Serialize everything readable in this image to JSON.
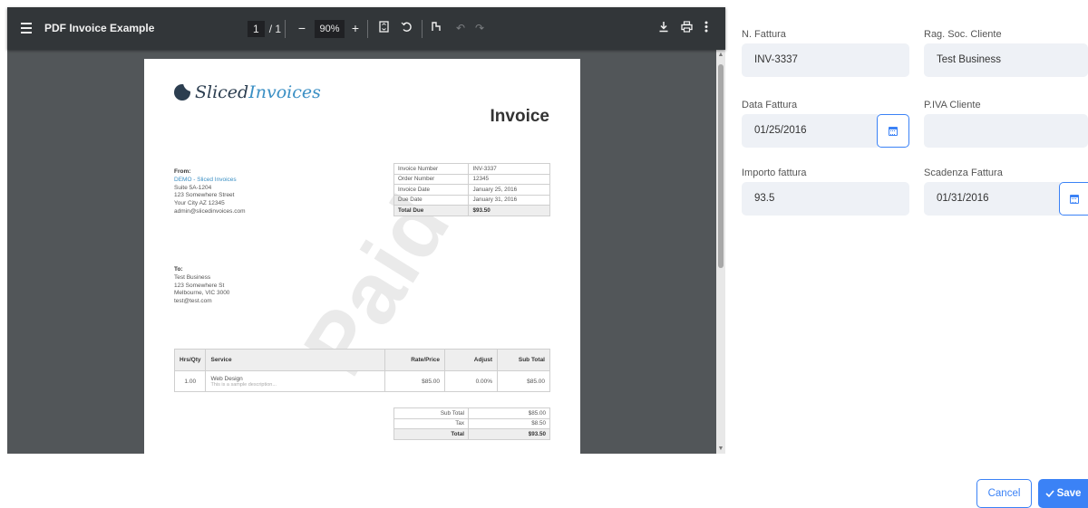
{
  "viewer": {
    "title": "PDF Invoice Example",
    "page_current": "1",
    "page_total": "/ 1",
    "zoom": "90%"
  },
  "pdf": {
    "logo_main": "Sliced",
    "logo_accent": "Invoices",
    "heading": "Invoice",
    "from": {
      "label": "From:",
      "name": "DEMO - Sliced Invoices",
      "line1": "Suite 5A-1204",
      "line2": "123 Somewhere Street",
      "line3": "Your City AZ 12345",
      "email": "admin@slicedinvoices.com"
    },
    "to": {
      "label": "To:",
      "name": "Test Business",
      "line1": "123 Somewhere St",
      "line2": "Melbourne, VIC 3000",
      "email": "test@test.com"
    },
    "meta": [
      {
        "label": "Invoice Number",
        "value": "INV-3337"
      },
      {
        "label": "Order Number",
        "value": "12345"
      },
      {
        "label": "Invoice Date",
        "value": "January 25, 2016"
      },
      {
        "label": "Due Date",
        "value": "January 31, 2016"
      },
      {
        "label": "Total Due",
        "value": "$93.50"
      }
    ],
    "items_header": {
      "qty": "Hrs/Qty",
      "service": "Service",
      "rate": "Rate/Price",
      "adjust": "Adjust",
      "subtotal": "Sub Total"
    },
    "items": [
      {
        "qty": "1.00",
        "service": "Web Design",
        "desc": "This is a sample description...",
        "rate": "$85.00",
        "adjust": "0.00%",
        "subtotal": "$85.00"
      }
    ],
    "totals": [
      {
        "label": "Sub Total",
        "value": "$85.00"
      },
      {
        "label": "Tax",
        "value": "$8.50"
      },
      {
        "label": "Total",
        "value": "$93.50"
      }
    ],
    "watermark": "Paid"
  },
  "form": {
    "invoice_number": {
      "label": "N. Fattura",
      "value": "INV-3337"
    },
    "client_name": {
      "label": "Rag. Soc. Cliente",
      "value": "Test Business"
    },
    "invoice_date": {
      "label": "Data Fattura",
      "value": "01/25/2016"
    },
    "client_vat": {
      "label": "P.IVA Cliente",
      "value": ""
    },
    "amount": {
      "label": "Importo fattura",
      "value": "93.5"
    },
    "due_date": {
      "label": "Scadenza Fattura",
      "value": "01/31/2016"
    }
  },
  "actions": {
    "cancel_label": "Cancel",
    "save_label": "Save",
    "save_icon": "checkmark-icon"
  },
  "colors": {
    "accent": "#3b82f6",
    "field_bg": "#eef1f6",
    "viewer_toolbar": "#323639",
    "viewer_bg": "#525659"
  }
}
